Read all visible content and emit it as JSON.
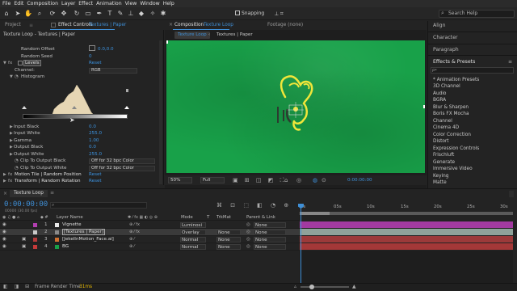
{
  "menu": [
    "File",
    "Edit",
    "Composition",
    "Layer",
    "Effect",
    "Animation",
    "View",
    "Window",
    "Help"
  ],
  "toolbar": {
    "snapping_label": "Snapping",
    "search_placeholder": "Search Help"
  },
  "project_tab": "Project",
  "ec": {
    "tab_label": "Effect Controls",
    "tab_target": "Textures | Paper",
    "header": "Texture Loop - Textures | Paper",
    "random_offset_label": "Random Offset",
    "random_offset_value": "0.0,0.0",
    "random_seed_label": "Random Seed",
    "random_seed_value": "0",
    "levels_label": "Levels",
    "levels_reset": "Reset",
    "channel_label": "Channel:",
    "channel_value": "RGB",
    "histogram_label": "Histogram",
    "input_black_label": "Input Black",
    "input_black_value": "0.0",
    "input_white_label": "Input White",
    "input_white_value": "255.0",
    "gamma_label": "Gamma",
    "gamma_value": "1.00",
    "output_black_label": "Output Black",
    "output_black_value": "0.0",
    "output_white_label": "Output White",
    "output_white_value": "255.0",
    "clip_black_label": "Clip To Output Black",
    "clip_black_value": "Off for 32 bpc Color",
    "clip_white_label": "Clip To Output White",
    "clip_white_value": "Off for 32 bpc Color",
    "motion_tile_label": "Motion Tile | Random Position",
    "motion_tile_reset": "Reset",
    "transform_label": "Transform | Random Rotation",
    "transform_reset": "Reset"
  },
  "comp": {
    "tab_label": "Composition",
    "tab_name": "Texture Loop",
    "footage_tab": "Footage (none)",
    "breadcrumb_1": "Texture Loop",
    "breadcrumb_2": "Textures | Paper",
    "zoom": "50%",
    "resolution": "Full",
    "timecode": "0:00:00:00",
    "bg_color": "#18a149"
  },
  "right": {
    "align": "Align",
    "character": "Character",
    "paragraph": "Paragraph",
    "effects_presets": "Effects & Presets",
    "search_glyph": "ρ•",
    "items": [
      "* Animation Presets",
      "3D Channel",
      "Audio",
      "BGRA",
      "Blur & Sharpen",
      "Boris FX Mocha",
      "Channel",
      "Cinema 4D",
      "Color Correction",
      "Distort",
      "Expression Controls",
      "Frischluft",
      "Generate",
      "Immersive Video",
      "Keying",
      "Matte"
    ]
  },
  "timeline": {
    "tab_label": "Texture Loop",
    "timecode": "0:00:00:00",
    "timecode_sub": "00000 (30.00 fps)",
    "col_layer_name": "Layer Name",
    "col_mode": "Mode",
    "col_t": "T",
    "col_trkmat": "TrkMat",
    "col_parent": "Parent & Link",
    "ruler": [
      "0s",
      "05s",
      "10s",
      "15s",
      "20s",
      "25s",
      "30s"
    ],
    "layers": [
      {
        "num": "1",
        "name": "Vignette",
        "mode": "Luminosi",
        "trkmat": "",
        "parent": "None",
        "color": "#b23fb0",
        "bar": "#a23aa0"
      },
      {
        "num": "2",
        "name": "[Textures | Paper]",
        "mode": "Overlay",
        "trkmat": "None",
        "parent": "None",
        "color": "#c9c9c9",
        "bar": "#8fa29a"
      },
      {
        "num": "3",
        "name": "[JekelInMotion_Face.ai]",
        "mode": "Normal",
        "trkmat": "None",
        "parent": "None",
        "color": "#b33a3a",
        "bar": "#9c3a3a"
      },
      {
        "num": "4",
        "name": "BG",
        "mode": "Normal",
        "trkmat": "None",
        "parent": "None",
        "color": "#c43a3a",
        "bar": "#a43838"
      }
    ]
  },
  "footer": {
    "frame_render_label": "Frame Render Time:",
    "frame_render_value": "31ms"
  }
}
